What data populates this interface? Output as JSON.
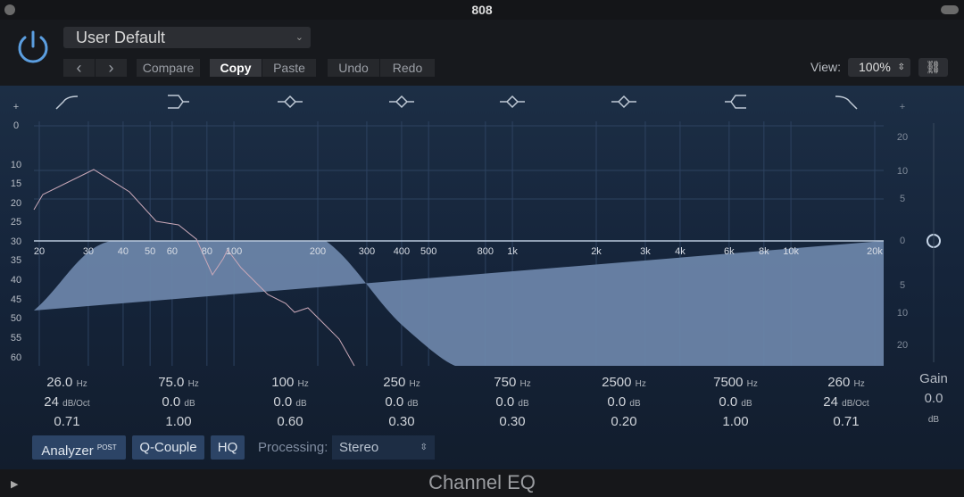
{
  "window": {
    "title": "808"
  },
  "header": {
    "preset": "User Default",
    "buttons": {
      "prev": "‹",
      "next": "›",
      "compare": "Compare",
      "copy": "Copy",
      "paste": "Paste",
      "undo": "Undo",
      "redo": "Redo"
    },
    "view_label": "View:",
    "view_value": "100%"
  },
  "graph": {
    "left_scale": [
      "+",
      "0",
      "10",
      "15",
      "20",
      "25",
      "30",
      "35",
      "40",
      "45",
      "50",
      "55",
      "60"
    ],
    "right_scale": [
      "+",
      "20",
      "10",
      "5",
      "0",
      "5",
      "10",
      "20"
    ],
    "freq_labels": [
      "20",
      "30",
      "40",
      "50",
      "60",
      "80",
      "100",
      "200",
      "300",
      "400",
      "500",
      "800",
      "1k",
      "2k",
      "3k",
      "4k",
      "6k",
      "8k",
      "10k",
      "20k"
    ],
    "band_icons": [
      "high-pass",
      "low-shelf",
      "bell",
      "bell",
      "bell",
      "bell",
      "high-shelf",
      "low-pass"
    ]
  },
  "bands": [
    {
      "freq": "26.0",
      "freq_unit": "Hz",
      "gain": "24",
      "gain_unit": "dB/Oct",
      "q": "0.71"
    },
    {
      "freq": "75.0",
      "freq_unit": "Hz",
      "gain": "0.0",
      "gain_unit": "dB",
      "q": "1.00"
    },
    {
      "freq": "100",
      "freq_unit": "Hz",
      "gain": "0.0",
      "gain_unit": "dB",
      "q": "0.60"
    },
    {
      "freq": "250",
      "freq_unit": "Hz",
      "gain": "0.0",
      "gain_unit": "dB",
      "q": "0.30"
    },
    {
      "freq": "750",
      "freq_unit": "Hz",
      "gain": "0.0",
      "gain_unit": "dB",
      "q": "0.30"
    },
    {
      "freq": "2500",
      "freq_unit": "Hz",
      "gain": "0.0",
      "gain_unit": "dB",
      "q": "0.20"
    },
    {
      "freq": "7500",
      "freq_unit": "Hz",
      "gain": "0.0",
      "gain_unit": "dB",
      "q": "1.00"
    },
    {
      "freq": "260",
      "freq_unit": "Hz",
      "gain": "24",
      "gain_unit": "dB/Oct",
      "q": "0.71"
    }
  ],
  "gain": {
    "label": "Gain",
    "value": "0.0",
    "unit": "dB"
  },
  "bottom": {
    "analyzer": "Analyzer",
    "analyzer_sup": "POST",
    "qcouple": "Q-Couple",
    "hq": "HQ",
    "processing_label": "Processing:",
    "processing_value": "Stereo"
  },
  "footer": {
    "plugin_name": "Channel EQ"
  },
  "colors": {
    "accent": "#5b9ee0",
    "eq_fill": "#6a84a8",
    "button_active": "#2c4466"
  }
}
